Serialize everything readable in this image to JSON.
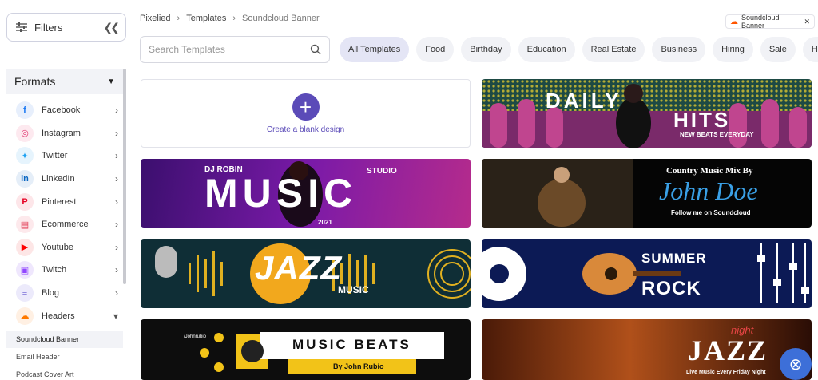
{
  "sidebar": {
    "filters_label": "Filters",
    "formats_label": "Formats",
    "items": [
      {
        "label": "Facebook",
        "icon": "facebook-icon",
        "glyph": "f",
        "color": "#1877f2",
        "bg": "#e7effc"
      },
      {
        "label": "Instagram",
        "icon": "instagram-icon",
        "glyph": "◎",
        "color": "#e1306c",
        "bg": "#fde9ef"
      },
      {
        "label": "Twitter",
        "icon": "twitter-icon",
        "glyph": "✦",
        "color": "#1da1f2",
        "bg": "#e6f4fd"
      },
      {
        "label": "LinkedIn",
        "icon": "linkedin-icon",
        "glyph": "in",
        "color": "#0a66c2",
        "bg": "#e5eef8"
      },
      {
        "label": "Pinterest",
        "icon": "pinterest-icon",
        "glyph": "P",
        "color": "#e60023",
        "bg": "#fde6e9"
      },
      {
        "label": "Ecommerce",
        "icon": "ecommerce-icon",
        "glyph": "▤",
        "color": "#e2445c",
        "bg": "#fde9ec"
      },
      {
        "label": "Youtube",
        "icon": "youtube-icon",
        "glyph": "▶",
        "color": "#ff0000",
        "bg": "#fde6e6"
      },
      {
        "label": "Twitch",
        "icon": "twitch-icon",
        "glyph": "▣",
        "color": "#9146ff",
        "bg": "#efe7fd"
      },
      {
        "label": "Blog",
        "icon": "blog-icon",
        "glyph": "≡",
        "color": "#7b6fd8",
        "bg": "#eceafb"
      },
      {
        "label": "Headers",
        "icon": "headers-icon",
        "glyph": "☁",
        "color": "#ff7a00",
        "bg": "#fff0e3"
      }
    ],
    "sub_items": [
      "Soundcloud Banner",
      "Email Header",
      "Podcast Cover Art"
    ]
  },
  "breadcrumb": [
    "Pixelied",
    "Templates",
    "Soundcloud Banner"
  ],
  "filter_chip": "Soundcloud Banner",
  "search": {
    "placeholder": "Search Templates"
  },
  "categories": [
    "All Templates",
    "Food",
    "Birthday",
    "Education",
    "Real Estate",
    "Business",
    "Hiring",
    "Sale",
    "Health"
  ],
  "blank": {
    "label": "Create a blank design"
  },
  "templates": {
    "daily": {
      "line1": "DAILY",
      "line2": "HITS",
      "sub": "NEW BEATS EVERYDAY"
    },
    "music": {
      "top_left": "DJ ROBIN",
      "top_right": "STUDIO",
      "main": "MUSIC",
      "year": "2021"
    },
    "country": {
      "line1": "Country Music Mix By",
      "name": "John Doe",
      "line2": "Follow me on Soundcloud"
    },
    "jazz": {
      "main": "JAZZ",
      "sub": "MUSIC"
    },
    "summer": {
      "line1": "SUMMER",
      "line2": "ROCK"
    },
    "beats": {
      "main": "MUSIC BEATS",
      "sub": "By John Rubio",
      "handle": "/Johnrubio"
    },
    "jazz2": {
      "small": "night",
      "main": "JAZZ",
      "sub": "Live Music Every Friday Night"
    }
  }
}
